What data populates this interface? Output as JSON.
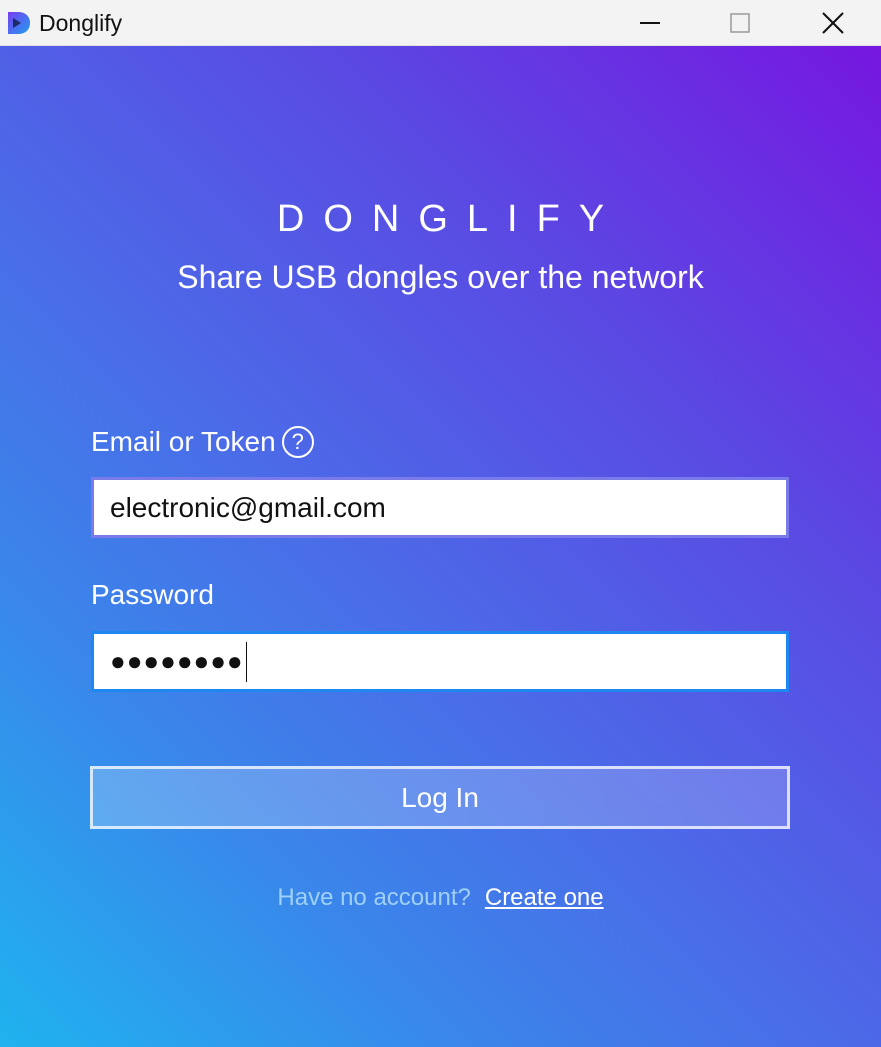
{
  "window": {
    "title": "Donglify"
  },
  "titlebar_icons": {
    "app": "donglify-logo-icon",
    "minimize": "minimize-icon",
    "maximize": "maximize-icon",
    "close": "close-icon"
  },
  "brand": {
    "name": "DONGLIFY",
    "tagline": "Share USB dongles over the network"
  },
  "form": {
    "email_label": "Email or Token",
    "help_icon_glyph": "?",
    "email_value": "electronic@gmail.com",
    "password_label": "Password",
    "password_masked": "●●●●●●●●",
    "login_label": "Log In"
  },
  "signup": {
    "prompt": "Have no account?",
    "link": "Create one"
  },
  "colors": {
    "gradient_top_right": "#7617e0",
    "gradient_bottom_left": "#1fb3ef",
    "email_border": "#7a7be8",
    "password_border": "#1e88f0",
    "signup_prompt": "#9fd0f5"
  }
}
